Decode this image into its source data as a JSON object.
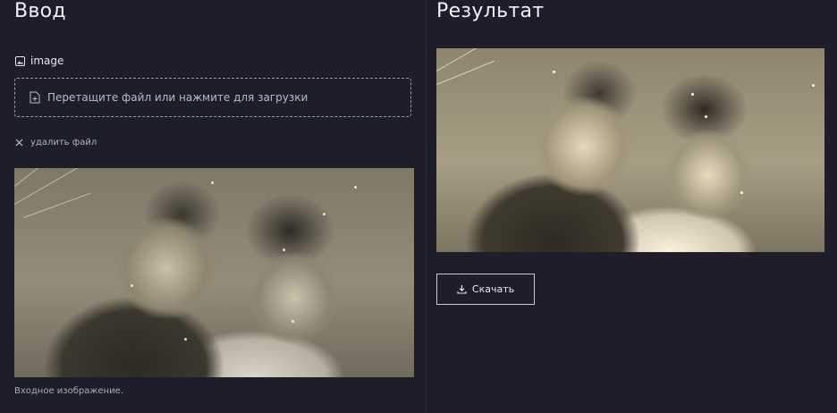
{
  "input": {
    "title": "Ввод",
    "field_label": "image",
    "dropzone_text": "Перетащите файл или нажмите для загрузки",
    "remove_text": "удалить файл",
    "caption": "Входное изображение."
  },
  "output": {
    "title": "Результат",
    "download_label": "Скачать"
  },
  "icons": {
    "image": "image-icon",
    "upload": "file-plus-icon",
    "remove": "close-icon",
    "download": "download-icon"
  },
  "colors": {
    "background": "#1e1e2b",
    "dropzone_border": "#9a9ab8",
    "button_border": "#c9c9d9"
  }
}
